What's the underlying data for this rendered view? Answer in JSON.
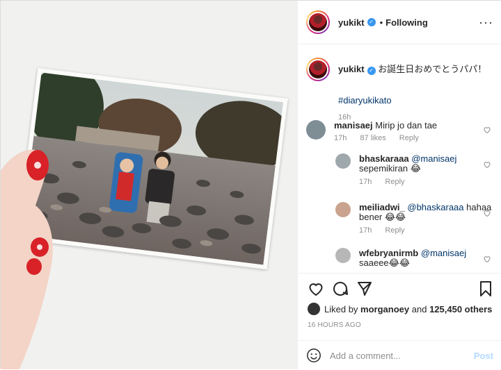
{
  "post": {
    "username": "yukikt",
    "follow_status": "Following",
    "caption_text": "お誕生日おめでとうパパ！",
    "hashtag": "#diaryukikato",
    "caption_age": "16h"
  },
  "comments": [
    {
      "user": "manisaej",
      "mention": "",
      "text": "Mirip jo dan tae",
      "age": "17h",
      "likes": "87 likes",
      "reply": "Reply"
    },
    {
      "user": "bhaskaraaa",
      "mention": "@manisaej",
      "text": "sepemikiran 😂",
      "age": "17h",
      "reply": "Reply"
    },
    {
      "user": "meiliadwi_",
      "mention": "@bhaskaraaa",
      "text": "hahaa",
      "text2": "bener 😂😂",
      "age": "17h",
      "reply": "Reply"
    },
    {
      "user": "wfebryanirmb",
      "mention": "@manisaej",
      "text": "saaeee😂😂"
    }
  ],
  "likes": {
    "prefix": "Liked by",
    "first_user": "morganoey",
    "conj": "and",
    "others": "125,450 others"
  },
  "timestamp": "16 HOURS AGO",
  "comment_box": {
    "placeholder": "Add a comment...",
    "post_label": "Post"
  },
  "icons": {
    "header_more": "more-horiz-icon",
    "verified": "verified-badge-icon",
    "like": "heart-icon",
    "comment": "comment-icon",
    "share": "share-icon",
    "save": "bookmark-icon",
    "emoji": "emoji-icon"
  },
  "colors": {
    "verified_blue": "#3897f0",
    "link": "#003569",
    "muted": "#8e8e8e",
    "post_disabled": "#b3dbff"
  }
}
